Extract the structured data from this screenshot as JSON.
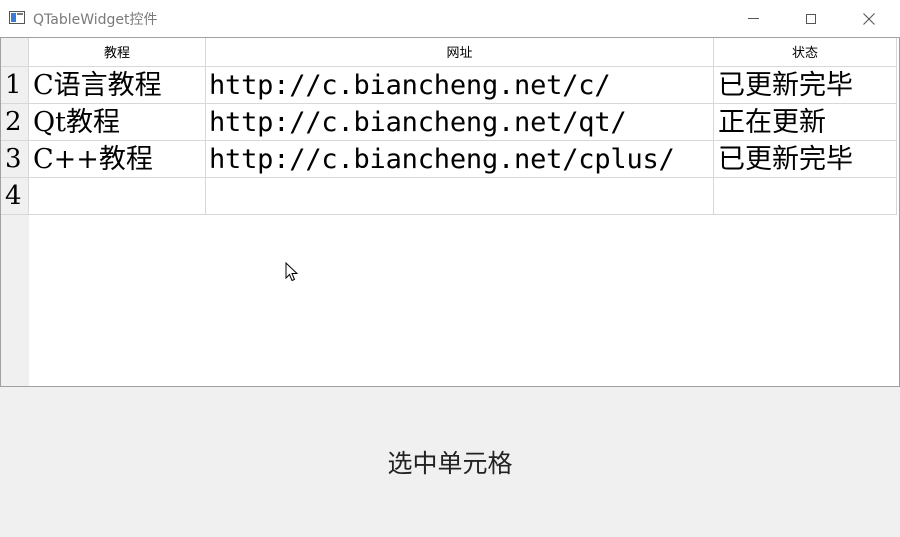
{
  "window": {
    "title": "QTableWidget控件",
    "icon": "qt-window-icon",
    "controls": [
      "minimize-icon",
      "maximize-icon",
      "close-icon"
    ]
  },
  "table": {
    "headers": [
      "教程",
      "网址",
      "状态"
    ],
    "row_labels": [
      "1",
      "2",
      "3",
      "4"
    ],
    "rows": [
      [
        "C语言教程",
        "http://c.biancheng.net/c/",
        "已更新完毕"
      ],
      [
        "Qt教程",
        "http://c.biancheng.net/qt/",
        "正在更新"
      ],
      [
        "C++教程",
        "http://c.biancheng.net/cplus/",
        "已更新完毕"
      ],
      [
        "",
        "",
        ""
      ]
    ]
  },
  "actions": {
    "select_cell_label": "选中单元格"
  },
  "colors": {
    "window_bg": "#f0f0f0",
    "grid_line": "#d8d8d8",
    "title_text": "#7a7a7a"
  }
}
